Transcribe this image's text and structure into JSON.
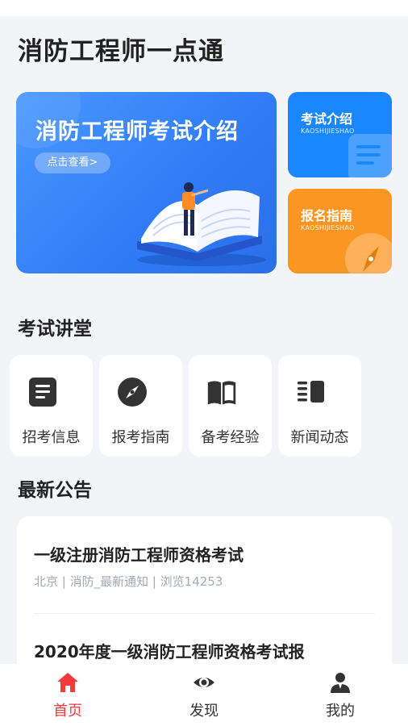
{
  "header": {
    "title": "消防工程师一点通"
  },
  "banner": {
    "title": "消防工程师考试介绍",
    "button": "点击查看>"
  },
  "cards": [
    {
      "title": "考试介绍",
      "subtitle": "KAOSHIJIESHAO",
      "color": "#1a86ff"
    },
    {
      "title": "报名指南",
      "subtitle": "KAOSHIJIESHAO",
      "color": "#fb9622"
    }
  ],
  "sections": {
    "lecture": "考试讲堂",
    "notices": "最新公告"
  },
  "lecture_items": [
    {
      "label": "招考信息",
      "icon": "document-icon"
    },
    {
      "label": "报考指南",
      "icon": "compass-icon"
    },
    {
      "label": "备考经验",
      "icon": "book-icon"
    },
    {
      "label": "新闻动态",
      "icon": "news-icon"
    }
  ],
  "notices": [
    {
      "title": "一级注册消防工程师资格考试",
      "meta": "北京 | 消防_最新通知 | 浏览14253"
    },
    {
      "title": "2020年度一级消防工程师资格考试报"
    }
  ],
  "tabs": [
    {
      "label": "首页",
      "icon": "home-icon",
      "active": true
    },
    {
      "label": "发现",
      "icon": "eye-icon",
      "active": false
    },
    {
      "label": "我的",
      "icon": "user-icon",
      "active": false
    }
  ],
  "colors": {
    "accent": "#f23b3b",
    "primary": "#2f7cf6",
    "orange": "#fb9622"
  }
}
